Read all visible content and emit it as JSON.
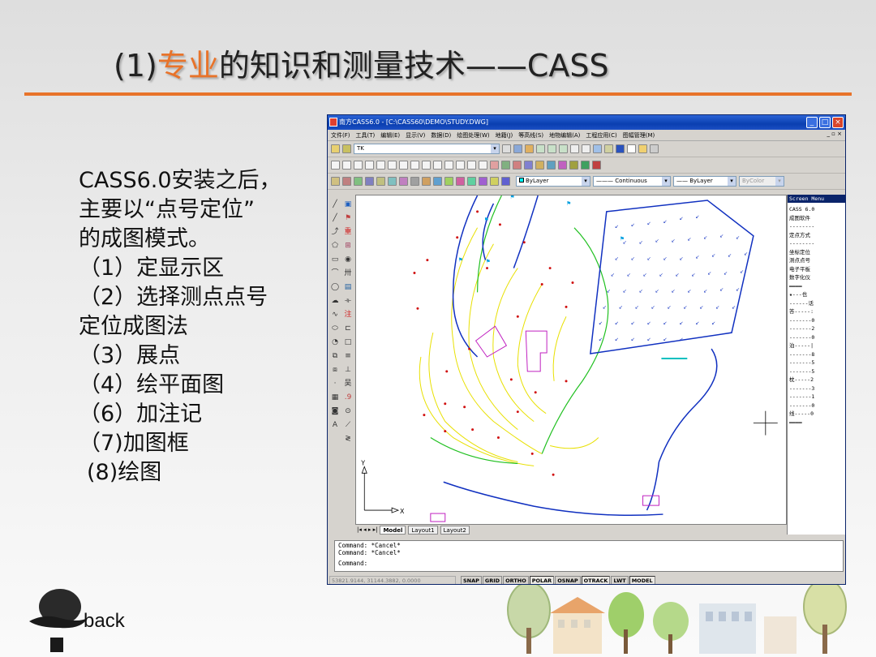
{
  "slide": {
    "title_prefix": "(1)",
    "title_highlight": "专业",
    "title_rest": "的知识和测量技术——CASS",
    "accent_color": "#e8732a"
  },
  "bullets": [
    "CASS6.0安装之后，",
    "主要以“点号定位”",
    "的成图模式。",
    "（1）定显示区",
    "（2）选择测点点号",
    "定位成图法",
    "（3）展点",
    "（4）绘平面图",
    "（6）加注记",
    "（7)加图框",
    "(8)绘图"
  ],
  "back": {
    "label": "back",
    "icon": "bowler-hat-icon"
  },
  "window": {
    "title": "南方CASS6.0 - [C:\\CASS60\\DEMO\\STUDY.DWG]",
    "menu": [
      "文件(F)",
      "工具(T)",
      "编辑(E)",
      "显示(V)",
      "数据(D)",
      "绘图处理(W)",
      "地籍(J)",
      "等高线(S)",
      "地物编辑(A)",
      "工程应用(C)",
      "图幅管理(M)"
    ],
    "layer_combo": "TK",
    "color_combo": "ByLayer",
    "linetype_combo": "Continuous",
    "lineweight_combo": "ByLayer",
    "plotstyle_combo": "ByColor",
    "layout_tabs": [
      "Model",
      "Layout1",
      "Layout2"
    ],
    "screen_menu": {
      "header": "Screen Menu",
      "items": [
        "CASS 6.0",
        "成图软件",
        "--------",
        "定点方式",
        "--------",
        "坐标定位",
        "测点点号",
        "电子平板",
        "数字化仪",
        "════",
        "★---也",
        "------话",
        "答-----:",
        "-------0",
        "-------2",
        "-------0",
        "泊-----|",
        "-------8",
        "-------5",
        "-------5",
        "枕-----2",
        "-------3",
        "-------1",
        "-------0",
        "线-----0",
        "════"
      ]
    },
    "command_lines": [
      "Command: *Cancel*",
      "Command: *Cancel*",
      "Command:"
    ],
    "status": {
      "coords": "53821.9144, 31144.3882, 0.0000",
      "modes": [
        "SNAP",
        "GRID",
        "ORTHO",
        "POLAR",
        "OSNAP",
        "OTRACK",
        "LWT",
        "MODEL"
      ],
      "active_modes": [
        "POLAR",
        "OTRACK",
        "MODEL"
      ]
    },
    "ucs": {
      "x_label": "X",
      "y_label": "Y"
    }
  }
}
